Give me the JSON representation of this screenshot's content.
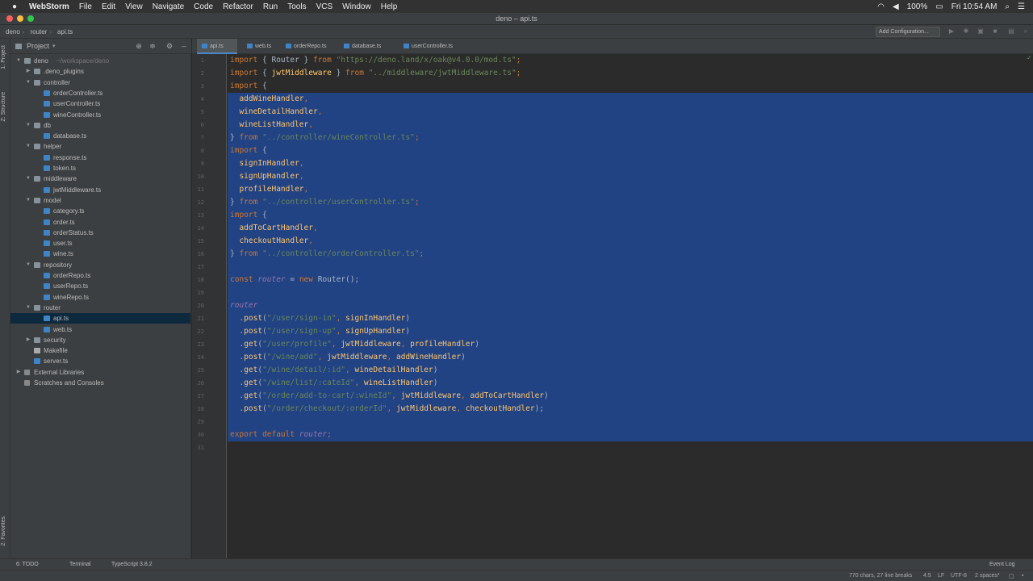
{
  "menubar": {
    "app": "WebStorm",
    "items": [
      "File",
      "Edit",
      "View",
      "Navigate",
      "Code",
      "Refactor",
      "Run",
      "Tools",
      "VCS",
      "Window",
      "Help"
    ],
    "battery": "100%",
    "clock": "Fri 10:54 AM"
  },
  "window": {
    "title": "deno – api.ts"
  },
  "breadcrumbs": [
    "deno",
    "router",
    "api.ts"
  ],
  "navbar": {
    "add_configuration": "Add Configuration..."
  },
  "left_tabs": {
    "project": "1: Project",
    "structure": "Z: Structure",
    "favorites": "2: Favorites"
  },
  "project": {
    "title": "Project"
  },
  "tree": [
    {
      "depth": 0,
      "type": "folder",
      "open": true,
      "label": "deno",
      "hint": "~/workspace/deno"
    },
    {
      "depth": 1,
      "type": "folder",
      "open": false,
      "label": ".deno_plugins"
    },
    {
      "depth": 1,
      "type": "folder",
      "open": true,
      "label": "controller"
    },
    {
      "depth": 2,
      "type": "ts",
      "label": "orderController.ts"
    },
    {
      "depth": 2,
      "type": "ts",
      "label": "userController.ts"
    },
    {
      "depth": 2,
      "type": "ts",
      "label": "wineController.ts"
    },
    {
      "depth": 1,
      "type": "folder",
      "open": true,
      "label": "db"
    },
    {
      "depth": 2,
      "type": "ts",
      "label": "database.ts"
    },
    {
      "depth": 1,
      "type": "folder",
      "open": true,
      "label": "helper"
    },
    {
      "depth": 2,
      "type": "ts",
      "label": "response.ts"
    },
    {
      "depth": 2,
      "type": "ts",
      "label": "token.ts"
    },
    {
      "depth": 1,
      "type": "folder",
      "open": true,
      "label": "middleware"
    },
    {
      "depth": 2,
      "type": "ts",
      "label": "jwtMiddleware.ts"
    },
    {
      "depth": 1,
      "type": "folder",
      "open": true,
      "label": "model"
    },
    {
      "depth": 2,
      "type": "ts",
      "label": "category.ts"
    },
    {
      "depth": 2,
      "type": "ts",
      "label": "order.ts"
    },
    {
      "depth": 2,
      "type": "ts",
      "label": "orderStatus.ts"
    },
    {
      "depth": 2,
      "type": "ts",
      "label": "user.ts"
    },
    {
      "depth": 2,
      "type": "ts",
      "label": "wine.ts"
    },
    {
      "depth": 1,
      "type": "folder",
      "open": true,
      "label": "repository"
    },
    {
      "depth": 2,
      "type": "ts",
      "label": "orderRepo.ts"
    },
    {
      "depth": 2,
      "type": "ts",
      "label": "userRepo.ts"
    },
    {
      "depth": 2,
      "type": "ts",
      "label": "wineRepo.ts"
    },
    {
      "depth": 1,
      "type": "folder",
      "open": true,
      "label": "router"
    },
    {
      "depth": 2,
      "type": "ts",
      "label": "api.ts",
      "selected": true
    },
    {
      "depth": 2,
      "type": "ts",
      "label": "web.ts"
    },
    {
      "depth": 1,
      "type": "folder",
      "open": false,
      "label": "security"
    },
    {
      "depth": 1,
      "type": "file",
      "label": "Makefile"
    },
    {
      "depth": 1,
      "type": "ts",
      "label": "server.ts"
    },
    {
      "depth": 0,
      "type": "lib",
      "open": false,
      "label": "External Libraries"
    },
    {
      "depth": 0,
      "type": "lib",
      "label": "Scratches and Consoles"
    }
  ],
  "tabs": [
    {
      "label": "api.ts",
      "active": true
    },
    {
      "label": "web.ts"
    },
    {
      "label": "orderRepo.ts"
    },
    {
      "label": "database.ts"
    },
    {
      "label": "userController.ts"
    }
  ],
  "code_lines": [
    [
      [
        "k",
        "import"
      ],
      [
        "c",
        " { Router } "
      ],
      [
        "k",
        "from"
      ],
      [
        "s",
        " \"https://deno.land/x/oak@v4.0.0/mod.ts\""
      ],
      [
        "k",
        ";"
      ]
    ],
    [
      [
        "k",
        "import"
      ],
      [
        "c",
        " { "
      ],
      [
        "f",
        "jwtMiddleware"
      ],
      [
        "c",
        " } "
      ],
      [
        "k",
        "from"
      ],
      [
        "s",
        " \"../middleware/jwtMiddleware.ts\""
      ],
      [
        "k",
        ";"
      ]
    ],
    [
      [
        "k",
        "import"
      ],
      [
        "c",
        " {"
      ]
    ],
    [
      [
        "c",
        "  "
      ],
      [
        "f",
        "addWineHandler"
      ],
      [
        "k",
        ","
      ]
    ],
    [
      [
        "c",
        "  "
      ],
      [
        "f",
        "wineDetailHandler"
      ],
      [
        "k",
        ","
      ]
    ],
    [
      [
        "c",
        "  "
      ],
      [
        "f",
        "wineListHandler"
      ],
      [
        "k",
        ","
      ]
    ],
    [
      [
        "c",
        "} "
      ],
      [
        "k",
        "from"
      ],
      [
        "s",
        " \"../controller/wineController.ts\""
      ],
      [
        "k",
        ";"
      ]
    ],
    [
      [
        "k",
        "import"
      ],
      [
        "c",
        " {"
      ]
    ],
    [
      [
        "c",
        "  "
      ],
      [
        "f",
        "signInHandler"
      ],
      [
        "k",
        ","
      ]
    ],
    [
      [
        "c",
        "  "
      ],
      [
        "f",
        "signUpHandler"
      ],
      [
        "k",
        ","
      ]
    ],
    [
      [
        "c",
        "  "
      ],
      [
        "f",
        "profileHandler"
      ],
      [
        "k",
        ","
      ]
    ],
    [
      [
        "c",
        "} "
      ],
      [
        "k",
        "from"
      ],
      [
        "s",
        " \"../controller/userController.ts\""
      ],
      [
        "k",
        ";"
      ]
    ],
    [
      [
        "k",
        "import"
      ],
      [
        "c",
        " {"
      ]
    ],
    [
      [
        "c",
        "  "
      ],
      [
        "f",
        "addToCartHandler"
      ],
      [
        "k",
        ","
      ]
    ],
    [
      [
        "c",
        "  "
      ],
      [
        "f",
        "checkoutHandler"
      ],
      [
        "k",
        ","
      ]
    ],
    [
      [
        "c",
        "} "
      ],
      [
        "k",
        "from"
      ],
      [
        "s",
        " \"../controller/orderController.ts\""
      ],
      [
        "k",
        ";"
      ]
    ],
    [],
    [
      [
        "k",
        "const"
      ],
      [
        "i",
        " router"
      ],
      [
        "c",
        " = "
      ],
      [
        "k",
        "new"
      ],
      [
        "c",
        " Router();"
      ]
    ],
    [],
    [
      [
        "i",
        "router"
      ]
    ],
    [
      [
        "c",
        "  ."
      ],
      [
        "f",
        "post"
      ],
      [
        "c",
        "("
      ],
      [
        "s",
        "\"/user/sign-in\""
      ],
      [
        "k",
        ", "
      ],
      [
        "f",
        "signInHandler"
      ],
      [
        "c",
        ")"
      ]
    ],
    [
      [
        "c",
        "  ."
      ],
      [
        "f",
        "post"
      ],
      [
        "c",
        "("
      ],
      [
        "s",
        "\"/user/sign-up\""
      ],
      [
        "k",
        ", "
      ],
      [
        "f",
        "signUpHandler"
      ],
      [
        "c",
        ")"
      ]
    ],
    [
      [
        "c",
        "  ."
      ],
      [
        "f",
        "get"
      ],
      [
        "c",
        "("
      ],
      [
        "s",
        "\"/user/profile\""
      ],
      [
        "k",
        ", "
      ],
      [
        "f",
        "jwtMiddleware"
      ],
      [
        "k",
        ", "
      ],
      [
        "f",
        "profileHandler"
      ],
      [
        "c",
        ")"
      ]
    ],
    [
      [
        "c",
        "  ."
      ],
      [
        "f",
        "post"
      ],
      [
        "c",
        "("
      ],
      [
        "s",
        "\"/wine/add\""
      ],
      [
        "k",
        ", "
      ],
      [
        "f",
        "jwtMiddleware"
      ],
      [
        "k",
        ", "
      ],
      [
        "f",
        "addWineHandler"
      ],
      [
        "c",
        ")"
      ]
    ],
    [
      [
        "c",
        "  ."
      ],
      [
        "f",
        "get"
      ],
      [
        "c",
        "("
      ],
      [
        "s",
        "\"/wine/detail/:id\""
      ],
      [
        "k",
        ", "
      ],
      [
        "f",
        "wineDetailHandler"
      ],
      [
        "c",
        ")"
      ]
    ],
    [
      [
        "c",
        "  ."
      ],
      [
        "f",
        "get"
      ],
      [
        "c",
        "("
      ],
      [
        "s",
        "\"/wine/list/:cateId\""
      ],
      [
        "k",
        ", "
      ],
      [
        "f",
        "wineListHandler"
      ],
      [
        "c",
        ")"
      ]
    ],
    [
      [
        "c",
        "  ."
      ],
      [
        "f",
        "get"
      ],
      [
        "c",
        "("
      ],
      [
        "s",
        "\"/order/add-to-cart/:wineId\""
      ],
      [
        "k",
        ", "
      ],
      [
        "f",
        "jwtMiddleware"
      ],
      [
        "k",
        ", "
      ],
      [
        "f",
        "addToCartHandler"
      ],
      [
        "c",
        ")"
      ]
    ],
    [
      [
        "c",
        "  ."
      ],
      [
        "f",
        "post"
      ],
      [
        "c",
        "("
      ],
      [
        "s",
        "\"/order/checkout/:orderId\""
      ],
      [
        "k",
        ", "
      ],
      [
        "f",
        "jwtMiddleware"
      ],
      [
        "k",
        ", "
      ],
      [
        "f",
        "checkoutHandler"
      ],
      [
        "c",
        ");"
      ]
    ],
    [],
    [
      [
        "k",
        "export default"
      ],
      [
        "i",
        " router"
      ],
      [
        "k",
        ";"
      ]
    ],
    []
  ],
  "bottom_tools": {
    "todo": "6: TODO",
    "terminal": "Terminal",
    "typescript": "TypeScript 3.8.2",
    "event_log": "Event Log"
  },
  "status": {
    "chars": "770 chars, 27 line breaks",
    "position": "4:5",
    "line_sep": "LF",
    "encoding": "UTF-8",
    "indent": "2 spaces*"
  },
  "colors": {
    "selection": "#214283",
    "keyword": "#cc7832",
    "string": "#6a8759",
    "function": "#ffc66d",
    "identifier": "#9876aa"
  }
}
